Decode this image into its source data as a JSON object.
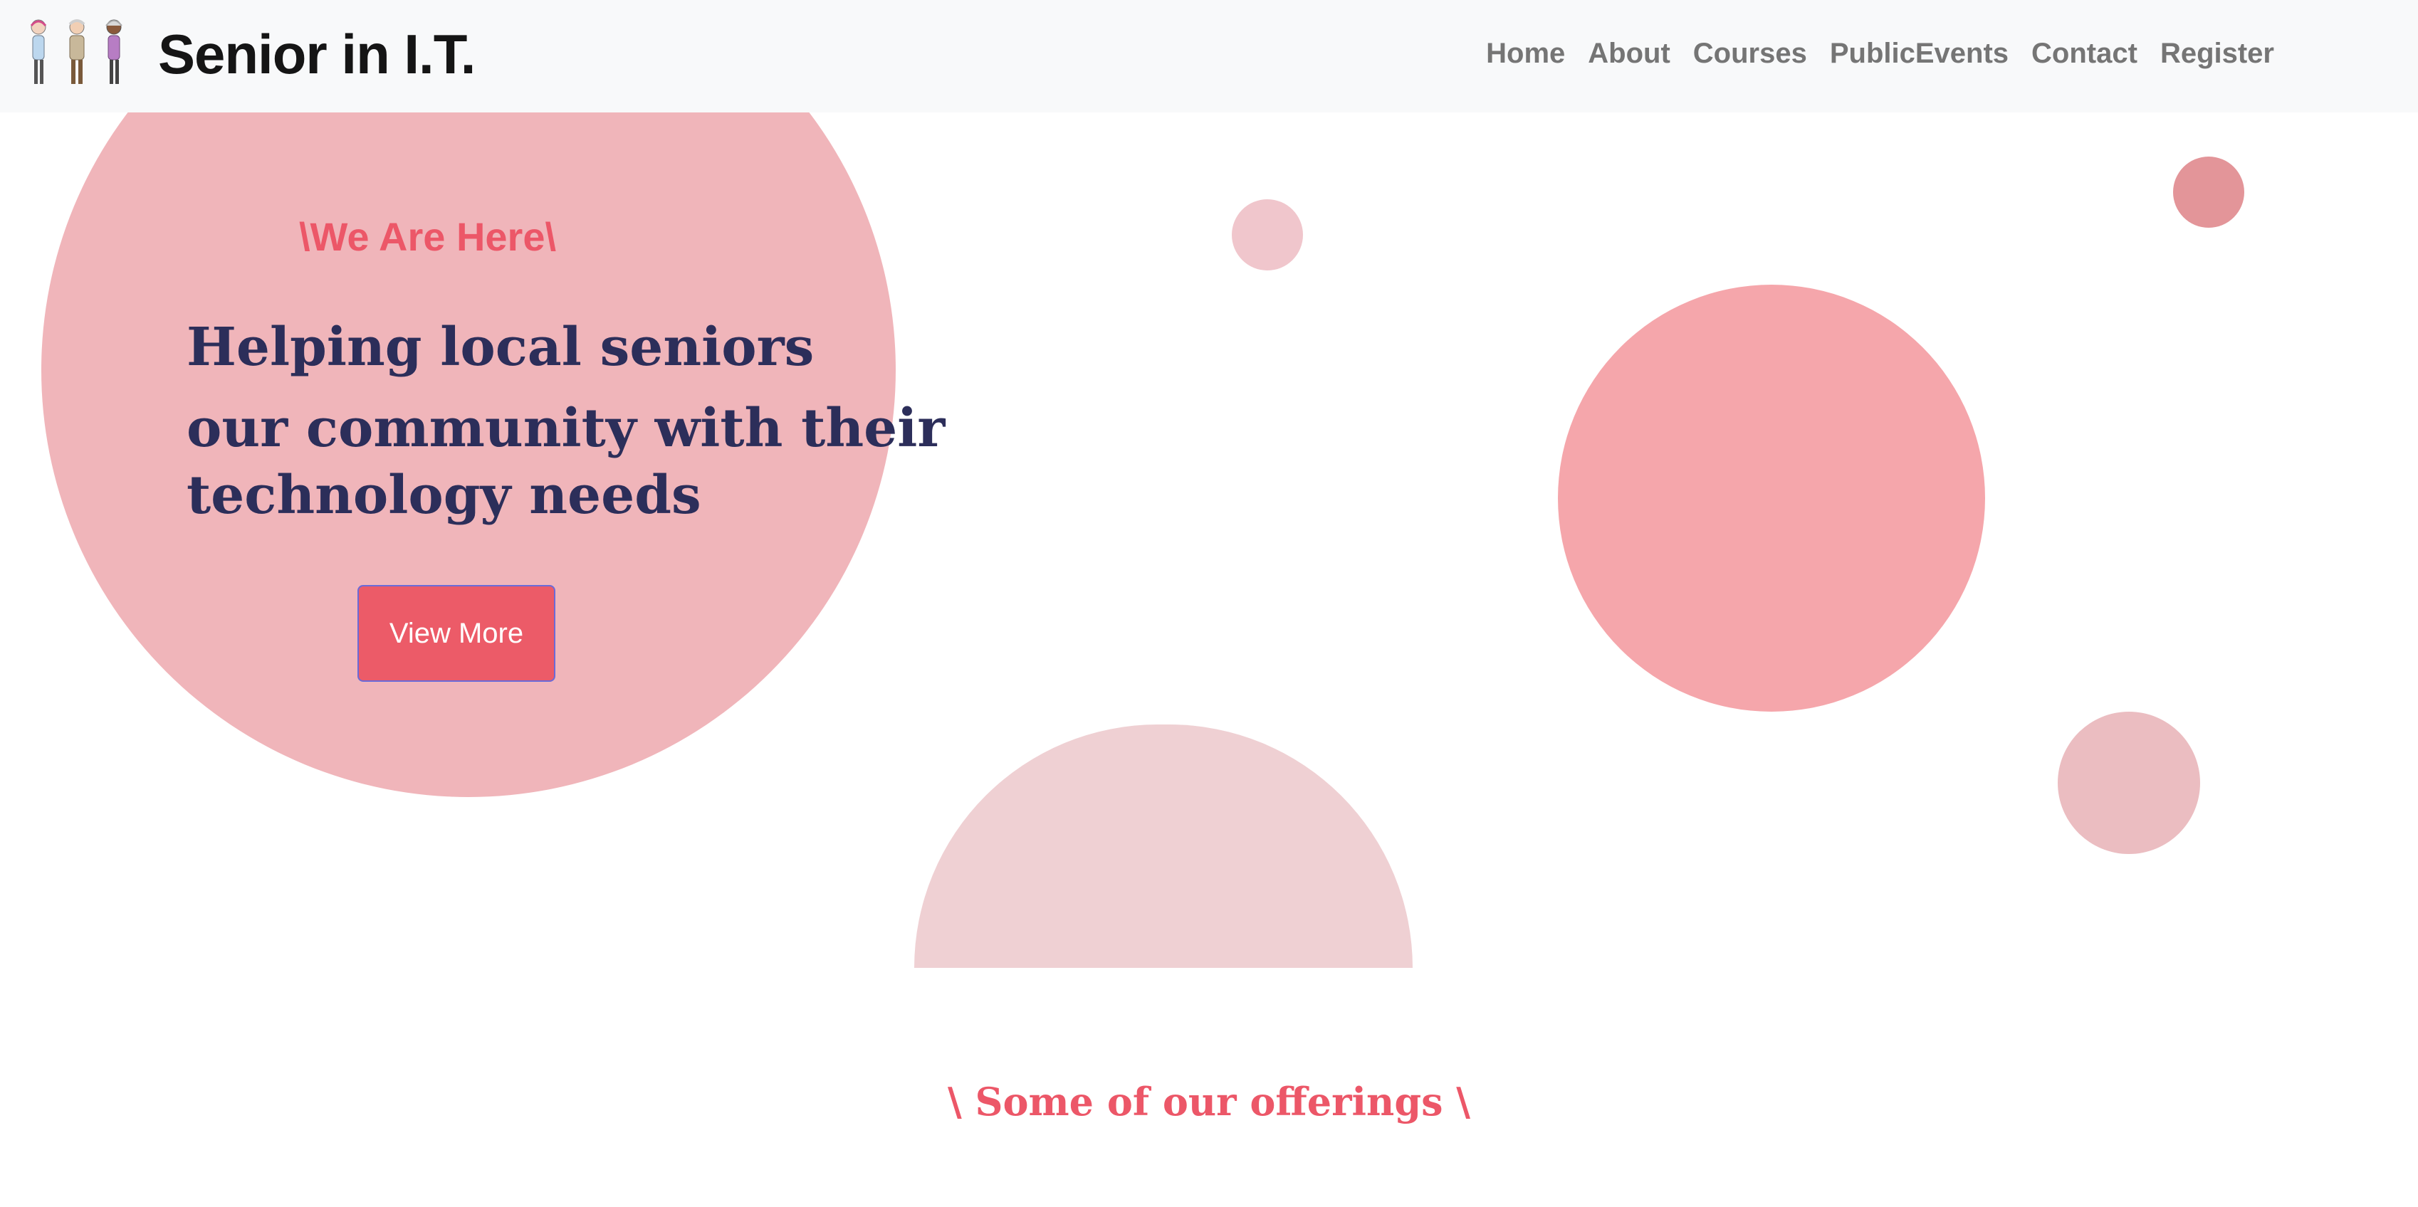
{
  "navbar": {
    "brand": "Senior in I.T.",
    "logo_icon": "three-seniors-figures-icon",
    "links": [
      "Home",
      "About",
      "Courses",
      "PublicEvents",
      "Contact",
      "Register"
    ]
  },
  "hero": {
    "tagline": "\\We Are Here\\",
    "headline_line1": "Helping local seniors",
    "headline_line2": "our community with their",
    "headline_line3": "technology needs",
    "button_label": "View More"
  },
  "offerings": {
    "title": "\\ Some of our offerings \\"
  },
  "colors": {
    "accent": "#ec5768",
    "headline": "#2c2e5a",
    "big_circle": "#f0b5ba",
    "navbar_bg": "#f8f9fa",
    "nav_text": "#757575"
  }
}
